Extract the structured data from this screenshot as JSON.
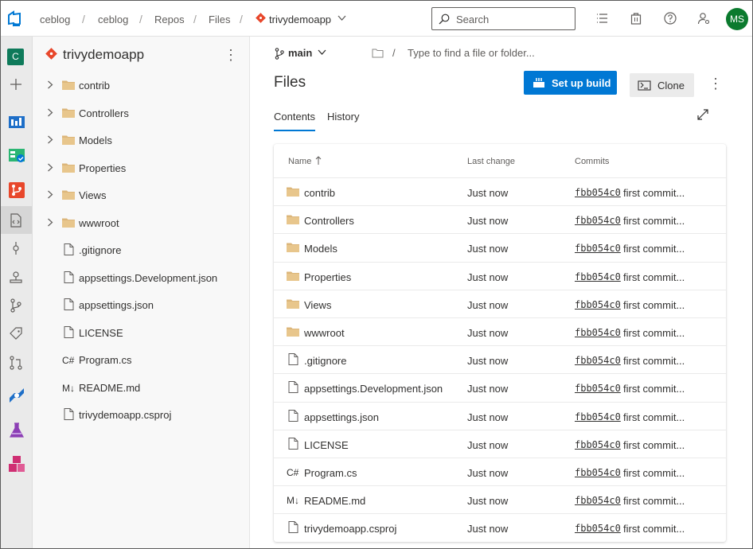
{
  "breadcrumb": {
    "org": "ceblog",
    "project": "ceblog",
    "section": "Repos",
    "page": "Files",
    "repo": "trivydemoapp"
  },
  "search": {
    "placeholder": "Search"
  },
  "user": {
    "initials": "MS"
  },
  "rail": {
    "project_letter": "C"
  },
  "tree": {
    "title": "trivydemoapp",
    "items": [
      {
        "label": "contrib",
        "type": "folder"
      },
      {
        "label": "Controllers",
        "type": "folder"
      },
      {
        "label": "Models",
        "type": "folder"
      },
      {
        "label": "Properties",
        "type": "folder"
      },
      {
        "label": "Views",
        "type": "folder"
      },
      {
        "label": "wwwroot",
        "type": "folder"
      },
      {
        "label": ".gitignore",
        "type": "file"
      },
      {
        "label": "appsettings.Development.json",
        "type": "file"
      },
      {
        "label": "appsettings.json",
        "type": "file"
      },
      {
        "label": "LICENSE",
        "type": "file"
      },
      {
        "label": "Program.cs",
        "type": "csharp",
        "glyph": "C#"
      },
      {
        "label": "README.md",
        "type": "markdown",
        "glyph": "M↓"
      },
      {
        "label": "trivydemoapp.csproj",
        "type": "file"
      }
    ]
  },
  "main": {
    "branch": "main",
    "path_placeholder": "Type to find a file or folder...",
    "title": "Files",
    "setup_build_label": "Set up build",
    "clone_label": "Clone",
    "tabs": [
      {
        "label": "Contents"
      },
      {
        "label": "History"
      }
    ],
    "table": {
      "headers": {
        "name": "Name",
        "last_change": "Last change",
        "commits": "Commits"
      },
      "rows": [
        {
          "name": "contrib",
          "type": "folder",
          "last_change": "Just now",
          "commit": "fbb054c0",
          "message": "first commit..."
        },
        {
          "name": "Controllers",
          "type": "folder",
          "last_change": "Just now",
          "commit": "fbb054c0",
          "message": "first commit..."
        },
        {
          "name": "Models",
          "type": "folder",
          "last_change": "Just now",
          "commit": "fbb054c0",
          "message": "first commit..."
        },
        {
          "name": "Properties",
          "type": "folder",
          "last_change": "Just now",
          "commit": "fbb054c0",
          "message": "first commit..."
        },
        {
          "name": "Views",
          "type": "folder",
          "last_change": "Just now",
          "commit": "fbb054c0",
          "message": "first commit..."
        },
        {
          "name": "wwwroot",
          "type": "folder",
          "last_change": "Just now",
          "commit": "fbb054c0",
          "message": "first commit..."
        },
        {
          "name": ".gitignore",
          "type": "file",
          "last_change": "Just now",
          "commit": "fbb054c0",
          "message": "first commit..."
        },
        {
          "name": "appsettings.Development.json",
          "type": "file",
          "last_change": "Just now",
          "commit": "fbb054c0",
          "message": "first commit..."
        },
        {
          "name": "appsettings.json",
          "type": "file",
          "last_change": "Just now",
          "commit": "fbb054c0",
          "message": "first commit..."
        },
        {
          "name": "LICENSE",
          "type": "file",
          "last_change": "Just now",
          "commit": "fbb054c0",
          "message": "first commit..."
        },
        {
          "name": "Program.cs",
          "type": "csharp",
          "glyph": "C#",
          "last_change": "Just now",
          "commit": "fbb054c0",
          "message": "first commit..."
        },
        {
          "name": "README.md",
          "type": "markdown",
          "glyph": "M↓",
          "last_change": "Just now",
          "commit": "fbb054c0",
          "message": "first commit..."
        },
        {
          "name": "trivydemoapp.csproj",
          "type": "file",
          "last_change": "Just now",
          "commit": "fbb054c0",
          "message": "first commit..."
        }
      ]
    }
  },
  "colors": {
    "accent": "#0078d4",
    "folder": "#dcb67a",
    "repo_icon": "#e8472b",
    "avatar": "#0b7a2e",
    "project_badge": "#0e7a5a"
  }
}
